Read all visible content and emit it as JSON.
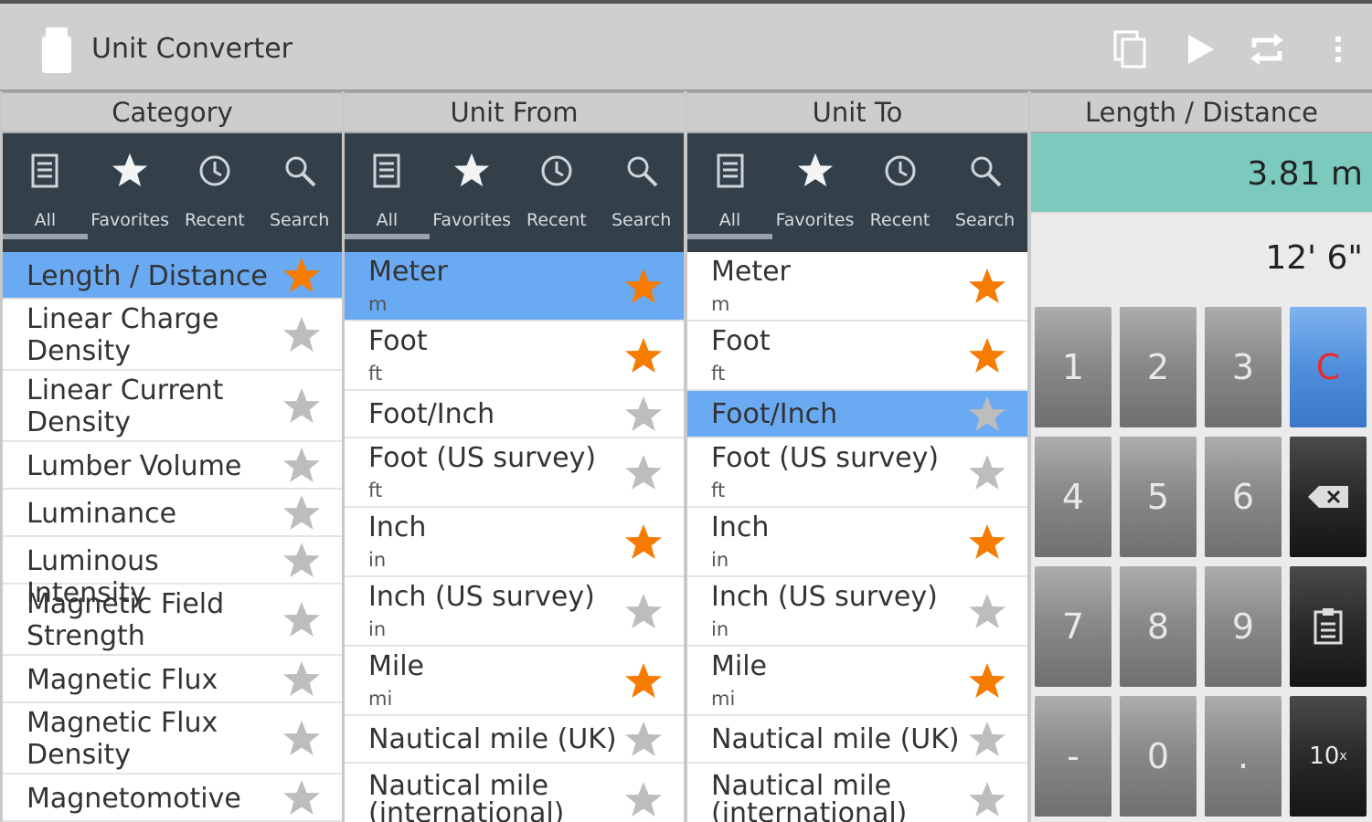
{
  "app": {
    "title": "Unit Converter",
    "actions": [
      "copy-icon",
      "play-icon",
      "swap-icon",
      "overflow-menu-icon"
    ]
  },
  "tabs": [
    "All",
    "Favorites",
    "Recent",
    "Search"
  ],
  "colors": {
    "accent_selected": "#6aaaf3",
    "star_on": "#f57c00",
    "star_off": "#bdbdbd",
    "tab_bar": "#33404a",
    "display": "#7ccabd"
  },
  "category": {
    "header": "Category",
    "items": [
      {
        "title": "Length / Distance",
        "fav": true,
        "selected": true
      },
      {
        "title": "Linear Charge Density",
        "fav": false
      },
      {
        "title": "Linear Current Density",
        "fav": false
      },
      {
        "title": "Lumber Volume",
        "fav": false
      },
      {
        "title": "Luminance",
        "fav": false
      },
      {
        "title": "Luminous Intensity",
        "fav": false
      },
      {
        "title": "Magnetic Field Strength",
        "fav": false
      },
      {
        "title": "Magnetic Flux",
        "fav": false
      },
      {
        "title": "Magnetic Flux Density",
        "fav": false
      },
      {
        "title": "Magnetomotive",
        "fav": false
      }
    ]
  },
  "unit_from": {
    "header": "Unit From",
    "items": [
      {
        "title": "Meter",
        "sub": "m",
        "fav": true,
        "selected": true
      },
      {
        "title": "Foot",
        "sub": "ft",
        "fav": true
      },
      {
        "title": "Foot/Inch",
        "sub": "",
        "fav": false
      },
      {
        "title": "Foot (US survey)",
        "sub": "ft",
        "fav": false
      },
      {
        "title": "Inch",
        "sub": "in",
        "fav": true
      },
      {
        "title": "Inch (US survey)",
        "sub": "in",
        "fav": false
      },
      {
        "title": "Mile",
        "sub": "mi",
        "fav": true
      },
      {
        "title": "Nautical mile (UK)",
        "sub": "",
        "fav": false
      },
      {
        "title": "Nautical mile (international)",
        "sub": "",
        "fav": false
      }
    ]
  },
  "unit_to": {
    "header": "Unit To",
    "items": [
      {
        "title": "Meter",
        "sub": "m",
        "fav": true
      },
      {
        "title": "Foot",
        "sub": "ft",
        "fav": true
      },
      {
        "title": "Foot/Inch",
        "sub": "",
        "fav": false,
        "selected": true
      },
      {
        "title": "Foot (US survey)",
        "sub": "ft",
        "fav": false
      },
      {
        "title": "Inch",
        "sub": "in",
        "fav": true
      },
      {
        "title": "Inch (US survey)",
        "sub": "in",
        "fav": false
      },
      {
        "title": "Mile",
        "sub": "mi",
        "fav": true
      },
      {
        "title": "Nautical mile (UK)",
        "sub": "",
        "fav": false
      },
      {
        "title": "Nautical mile (international)",
        "sub": "",
        "fav": false
      }
    ]
  },
  "result": {
    "header": "Length / Distance",
    "input_value": "3.81 m",
    "output_value": "12' 6\"",
    "keys": [
      "1",
      "2",
      "3",
      "C",
      "4",
      "5",
      "6",
      "backspace-icon",
      "7",
      "8",
      "9",
      "clipboard-icon",
      "-",
      "0",
      ".",
      "10x"
    ],
    "key_labels": {
      "exp_base": "10",
      "exp_sup": "x"
    }
  }
}
